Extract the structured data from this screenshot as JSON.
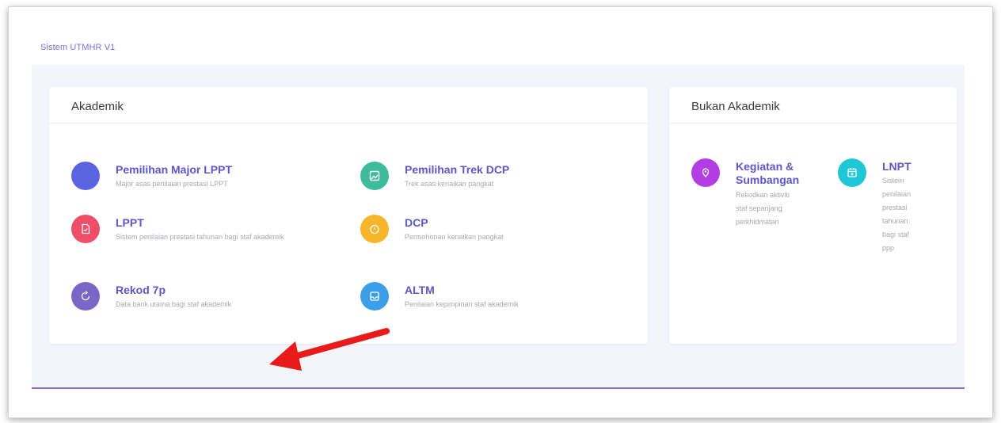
{
  "breadcrumb": "Sistem UTMHR V1",
  "akademik": {
    "title": "Akademik",
    "items": [
      {
        "title": "Pemilihan Major LPPT",
        "desc": "Major asas penilaian prestasi LPPT",
        "icon": "blank-circle-icon",
        "color": "#5c63e0"
      },
      {
        "title": "Pemilihan Trek DCP",
        "desc": "Trek asas kenaikan pangkat",
        "icon": "image-icon",
        "color": "#3dbb9a"
      },
      {
        "title": "LPPT",
        "desc": "Sistem penilaian prestasi tahunan bagi staf akademik",
        "icon": "document-icon",
        "color": "#ee4e67"
      },
      {
        "title": "DCP",
        "desc": "Permohonan kenaikan pangkat",
        "icon": "timer-icon",
        "color": "#f7b52a"
      },
      {
        "title": "Rekod 7p",
        "desc": "Data bank utama bagi staf akademik",
        "icon": "refresh-icon",
        "color": "#7a66c6"
      },
      {
        "title": "ALTM",
        "desc": "Penilaian kepimpinan staf akademik",
        "icon": "inbox-icon",
        "color": "#3d9ee8"
      }
    ]
  },
  "bukan_akademik": {
    "title": "Bukan Akademik",
    "items": [
      {
        "title": "Kegiatan & Sumbangan",
        "desc": "Rekodkan aktiviti staf sepanjang perkhidmatan",
        "icon": "location-icon",
        "color": "#b33de4"
      },
      {
        "title": "LNPT",
        "desc": "Sistem penilaian prestasi tahunan bagi staf ppp",
        "icon": "calendar-icon",
        "color": "#1ec6d6"
      }
    ]
  },
  "colors": {
    "accent": "#5d56c9",
    "annotation_arrow": "#e81a1a",
    "divider": "#9b6cc7"
  }
}
